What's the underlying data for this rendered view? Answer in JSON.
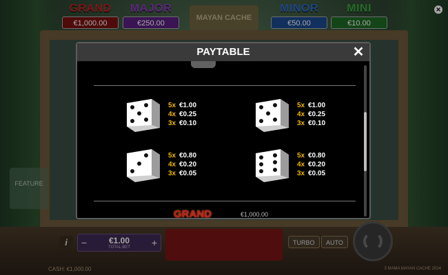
{
  "jackpots": {
    "grand": {
      "name": "GRAND",
      "value": "€1,000.00"
    },
    "major": {
      "name": "MAJOR",
      "value": "€250.00"
    },
    "minor": {
      "name": "MINOR",
      "value": "€50.00"
    },
    "mini": {
      "name": "MINI",
      "value": "€10.00"
    }
  },
  "game": {
    "logo_text": "MAYAN CACHE",
    "side_feature": "FEATURE",
    "stake_value": "€1.00",
    "stake_label": "TOTAL BET",
    "turbo_label": "TURBO",
    "auto_label": "AUTO",
    "cash_label": "CASH: €1,000.00",
    "footer_title": "3 MAMA MAYAN CACHE 2024"
  },
  "paytable": {
    "title": "PAYTABLE",
    "close_icon": "close-x-icon",
    "items": [
      {
        "die": "dice-five-icon",
        "pips": 5,
        "lines": [
          {
            "mult": "5x",
            "amount": "€1.00"
          },
          {
            "mult": "4x",
            "amount": "€0.25"
          },
          {
            "mult": "3x",
            "amount": "€0.10"
          }
        ]
      },
      {
        "die": "dice-five-icon",
        "pips": 5,
        "lines": [
          {
            "mult": "5x",
            "amount": "€1.00"
          },
          {
            "mult": "4x",
            "amount": "€0.25"
          },
          {
            "mult": "3x",
            "amount": "€0.10"
          }
        ]
      },
      {
        "die": "dice-three-icon",
        "pips": 3,
        "lines": [
          {
            "mult": "5x",
            "amount": "€0.80"
          },
          {
            "mult": "4x",
            "amount": "€0.20"
          },
          {
            "mult": "3x",
            "amount": "€0.05"
          }
        ]
      },
      {
        "die": "dice-six-icon",
        "pips": 6,
        "lines": [
          {
            "mult": "5x",
            "amount": "€0.80"
          },
          {
            "mult": "4x",
            "amount": "€0.20"
          },
          {
            "mult": "3x",
            "amount": "€0.05"
          }
        ]
      }
    ],
    "grand_label": "GRAND",
    "grand_amount": "€1,000.00"
  },
  "colors": {
    "multiplier": "#f0b400",
    "header_bg": "#3a3a3a",
    "grand": "#c11d1d"
  }
}
